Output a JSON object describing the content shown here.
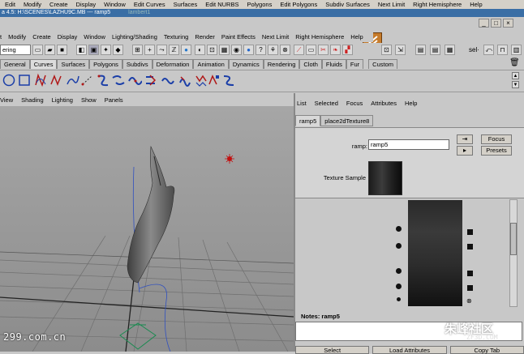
{
  "top_menu": [
    "Edit",
    "Modify",
    "Create",
    "Display",
    "Window",
    "Edit Curves",
    "Surfaces",
    "Edit NURBS",
    "Polygons",
    "Edit Polygons",
    "Subdiv Surfaces",
    "Next Limit",
    "Right Hemisphere",
    "Help"
  ],
  "title_bar": {
    "text": "a 4.5: H:\\SCENES\\LAZHU9C.MB  ---  ramp5",
    "ghost": "lambert1"
  },
  "window_controls": [
    "_",
    "□",
    "×"
  ],
  "maya_menu": [
    "t",
    "Modify",
    "Create",
    "Display",
    "Window",
    "Lighting/Shading",
    "Texturing",
    "Render",
    "Paint Effects",
    "Next Limit",
    "Right Hemisphere",
    "Help"
  ],
  "status_line": {
    "mode_value": "ering",
    "sel_label": "sel·"
  },
  "shelf_tabs": [
    "General",
    "Curves",
    "Surfaces",
    "Polygons",
    "Subdivs",
    "Deformation",
    "Animation",
    "Dynamics",
    "Rendering",
    "Cloth",
    "Fluids",
    "Fur",
    "Custom"
  ],
  "active_shelf_tab": "Curves",
  "viewport_menu": [
    "View",
    "Shading",
    "Lighting",
    "Show",
    "Panels"
  ],
  "attr_menu": [
    "List",
    "Selected",
    "Focus",
    "Attributes",
    "Help"
  ],
  "attr_tabs": [
    "ramp5",
    "place2dTexture8"
  ],
  "attr": {
    "ramp_label": "ramp:",
    "ramp_value": "ramp5",
    "focus_label": "Focus",
    "presets_label": "Presets",
    "texture_sample_label": "Texture Sample"
  },
  "notes_label": "Notes: ramp5",
  "bottom_buttons": [
    "Select",
    "Load Attributes",
    "Copy Tab"
  ],
  "watermark_left": "299.com.cn",
  "watermark_right": "朱峰社区",
  "watermark_right_sub": "ZF3D.COM"
}
